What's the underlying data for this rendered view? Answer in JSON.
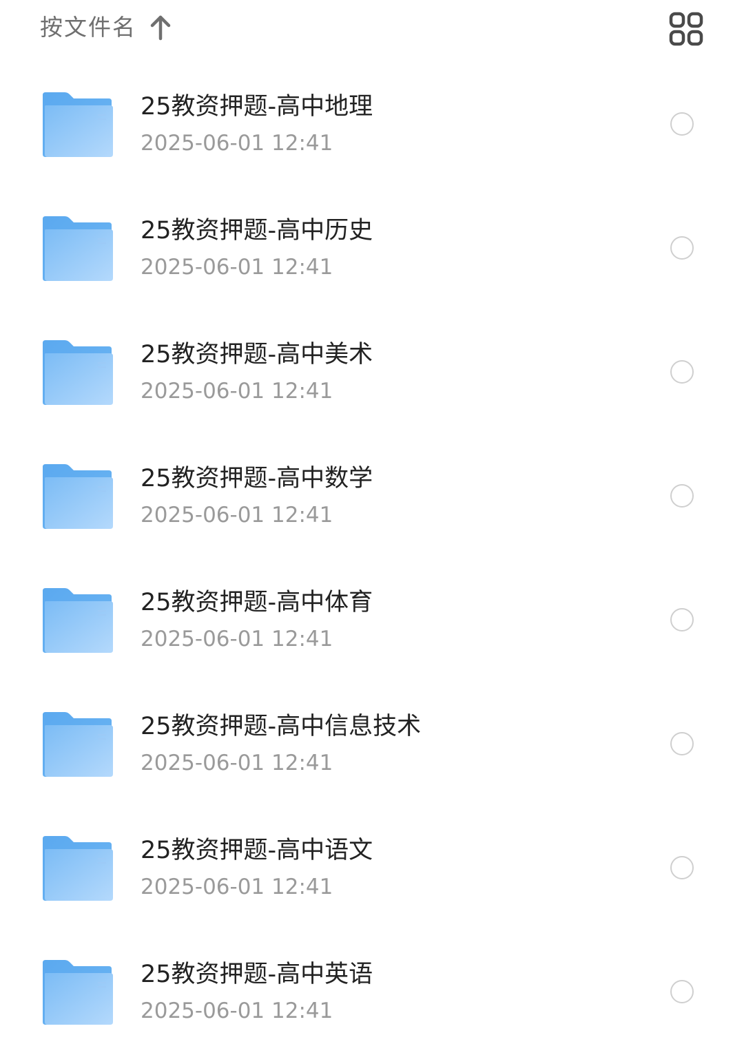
{
  "header": {
    "sort_label": "按文件名",
    "sort_direction_icon": "arrow-up-icon",
    "view_toggle_icon": "grid-view-icon"
  },
  "colors": {
    "folder_light": "#a9d3fb",
    "folder_dark": "#5ba9ef",
    "title_text": "#222222",
    "date_text": "#9a9a9a",
    "radio_border": "#cfcfcf"
  },
  "files": [
    {
      "name": "25教资押题-高中地理",
      "date": "2025-06-01 12:41"
    },
    {
      "name": "25教资押题-高中历史",
      "date": "2025-06-01 12:41"
    },
    {
      "name": "25教资押题-高中美术",
      "date": "2025-06-01 12:41"
    },
    {
      "name": "25教资押题-高中数学",
      "date": "2025-06-01 12:41"
    },
    {
      "name": "25教资押题-高中体育",
      "date": "2025-06-01 12:41"
    },
    {
      "name": "25教资押题-高中信息技术",
      "date": "2025-06-01 12:41"
    },
    {
      "name": "25教资押题-高中语文",
      "date": "2025-06-01 12:41"
    },
    {
      "name": "25教资押题-高中英语",
      "date": "2025-06-01 12:41"
    }
  ]
}
